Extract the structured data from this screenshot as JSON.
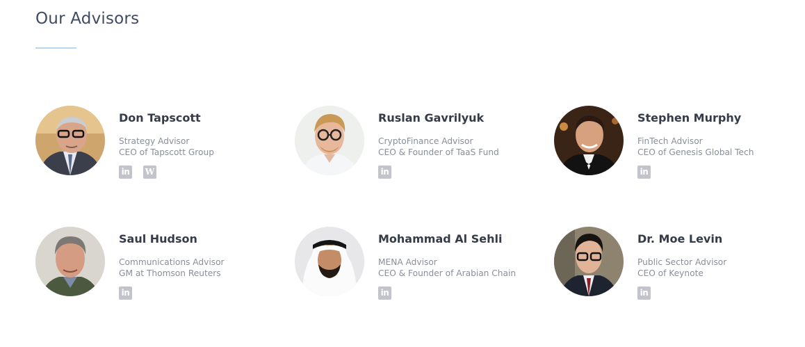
{
  "section": {
    "title": "Our Advisors"
  },
  "advisors": [
    {
      "name": "Don Tapscott",
      "role": "Strategy Advisor",
      "company": "CEO of Tapscott Group",
      "socials": [
        "linkedin",
        "wikipedia"
      ]
    },
    {
      "name": "Ruslan Gavrilyuk",
      "role": "CryptoFinance Advisor",
      "company": "CEO & Founder of TaaS Fund",
      "socials": [
        "linkedin"
      ]
    },
    {
      "name": "Stephen Murphy",
      "role": "FinTech Advisor",
      "company": "CEO of Genesis Global Tech",
      "socials": [
        "linkedin"
      ]
    },
    {
      "name": "Saul Hudson",
      "role": "Communications Advisor",
      "company": "GM at Thomson Reuters",
      "socials": [
        "linkedin"
      ]
    },
    {
      "name": "Mohammad Al Sehli",
      "role": "MENA Advisor",
      "company": "CEO & Founder of Arabian Chain",
      "socials": [
        "linkedin"
      ]
    },
    {
      "name": "Dr. Moe Levin",
      "role": "Public Sector Advisor",
      "company": "CEO of Keynote",
      "socials": [
        "linkedin"
      ]
    }
  ],
  "icons": {
    "linkedin": "in",
    "wikipedia": "W"
  },
  "colors": {
    "underline": "#b6d7f1",
    "social_icon_bg": "#c3c4cb"
  }
}
